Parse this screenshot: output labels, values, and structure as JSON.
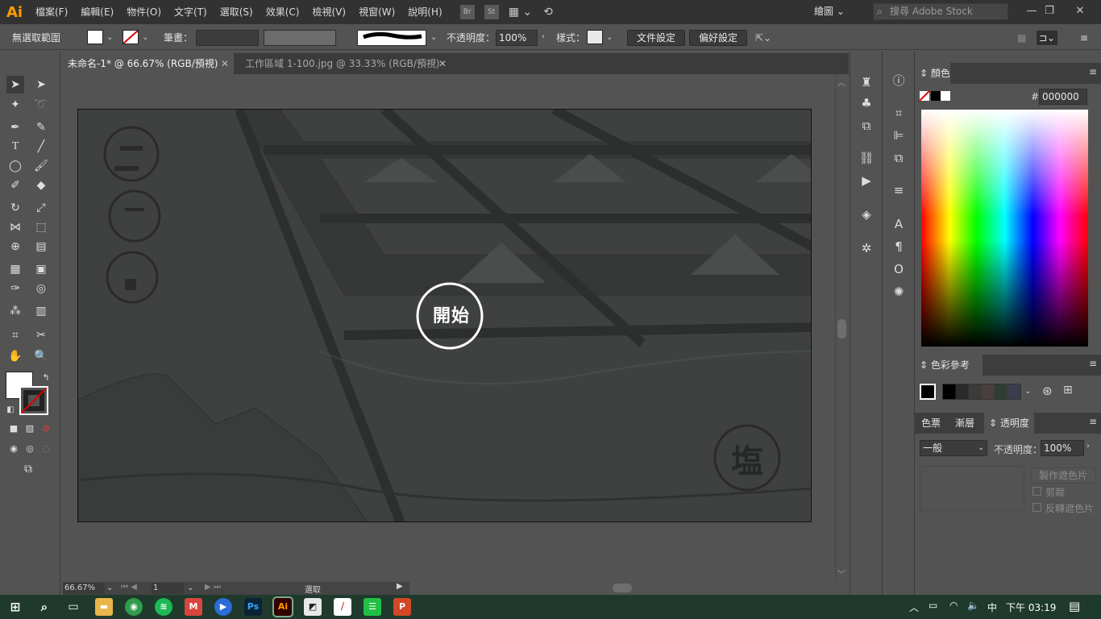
{
  "app": {
    "logo": "Ai",
    "accent": "#ff9a00"
  },
  "menu": [
    "檔案(F)",
    "編輯(E)",
    "物件(O)",
    "文字(T)",
    "選取(S)",
    "效果(C)",
    "檢視(V)",
    "視窗(W)",
    "說明(H)"
  ],
  "menu_badges": [
    "Br",
    "St"
  ],
  "workspace": "繪圖",
  "stock_search": {
    "placeholder": "搜尋 Adobe Stock"
  },
  "control": {
    "selection": "無選取範圍",
    "stroke_label": "筆畫：",
    "opacity_label": "不透明度：",
    "opacity_value": "100%",
    "style_label": "樣式：",
    "doc_setup": "文件設定",
    "preferences": "偏好設定"
  },
  "tabs": [
    {
      "label": "未命名-1* @ 66.67% (RGB/預視)",
      "active": true
    },
    {
      "label": "工作區域 1-100.jpg @ 33.33% (RGB/預視)",
      "active": false
    }
  ],
  "artboard": {
    "start_label": "開始",
    "salt_label": "塩"
  },
  "status": {
    "zoom": "66.67%",
    "page": "1",
    "tool": "選取"
  },
  "color_panel": {
    "title": "顏色",
    "hex_label": "#",
    "hex_value": "000000"
  },
  "color_guide": {
    "title": "色彩參考"
  },
  "bottom_panel": {
    "tabs": [
      "色票",
      "漸層",
      "透明度"
    ],
    "blend_mode": "一般",
    "opacity_label": "不透明度：",
    "opacity_value": "100%",
    "make_mask": "製作遮色片",
    "clip": "剪裁",
    "invert_mask": "反轉遮色片"
  },
  "taskbar": {
    "ime": "中",
    "time": "下午 03:19"
  }
}
